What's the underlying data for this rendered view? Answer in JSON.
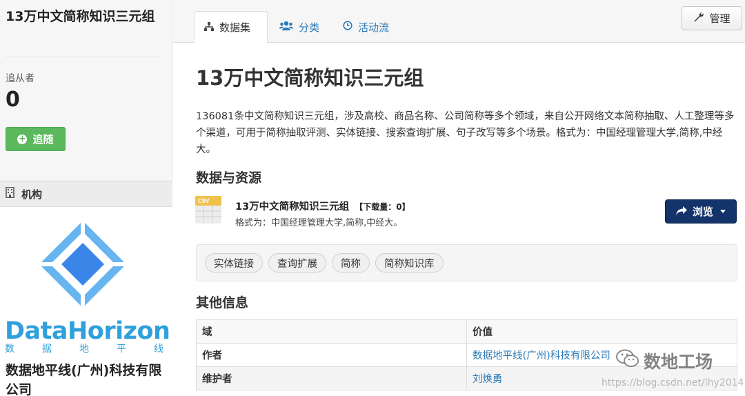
{
  "sidebar": {
    "title": "13万中文简称知识三元组",
    "followers_label": "追从者",
    "followers_count": "0",
    "follow_button": "追随",
    "org_header": "机构",
    "org_brand": "DataHorizon",
    "org_brand_sub": [
      "数",
      "据",
      "地",
      "平",
      "线"
    ],
    "org_name": "数据地平线(广州)科技有限公司"
  },
  "tabs": [
    {
      "label": "数据集",
      "icon": "sitemap-icon",
      "active": true
    },
    {
      "label": "分类",
      "icon": "users-icon",
      "active": false
    },
    {
      "label": "活动流",
      "icon": "clock-icon",
      "active": false
    }
  ],
  "manage_button": "管理",
  "dataset": {
    "title": "13万中文简称知识三元组",
    "description": "136081条中文简称知识三元组，涉及高校、商品名称、公司简称等多个领域，来自公开网络文本简称抽取、人工整理等多个渠道，可用于简称抽取评测、实体链接、搜索查询扩展、句子改写等多个场景。格式为：中国经理管理大学,简称,中经大。"
  },
  "resources_heading": "数据与资源",
  "resource": {
    "icon_label": "CSV",
    "name": "13万中文简称知识三元组",
    "download_count": "【下载量：0】",
    "format_line": "格式为：中国经理管理大学,简称,中经大。",
    "browse_button": "浏览"
  },
  "tags": [
    "实体链接",
    "查询扩展",
    "简称",
    "简称知识库"
  ],
  "other_info_heading": "其他信息",
  "info_table": {
    "headers": [
      "域",
      "价值"
    ],
    "rows": [
      {
        "key": "作者",
        "value": "数据地平线(广州)科技有限公司"
      },
      {
        "key": "维护者",
        "value": "刘焕勇"
      }
    ]
  },
  "watermark": {
    "text": "数地工场",
    "url": "https://blog.csdn.net/lhy2014"
  },
  "colors": {
    "link": "#2c7ab7",
    "follow_green": "#5cb85c",
    "browse_navy": "#13336a",
    "brand_blue": "#2ea1dc",
    "logo_dark_blue": "#3a86e8",
    "logo_light_blue": "#66b4f0"
  }
}
